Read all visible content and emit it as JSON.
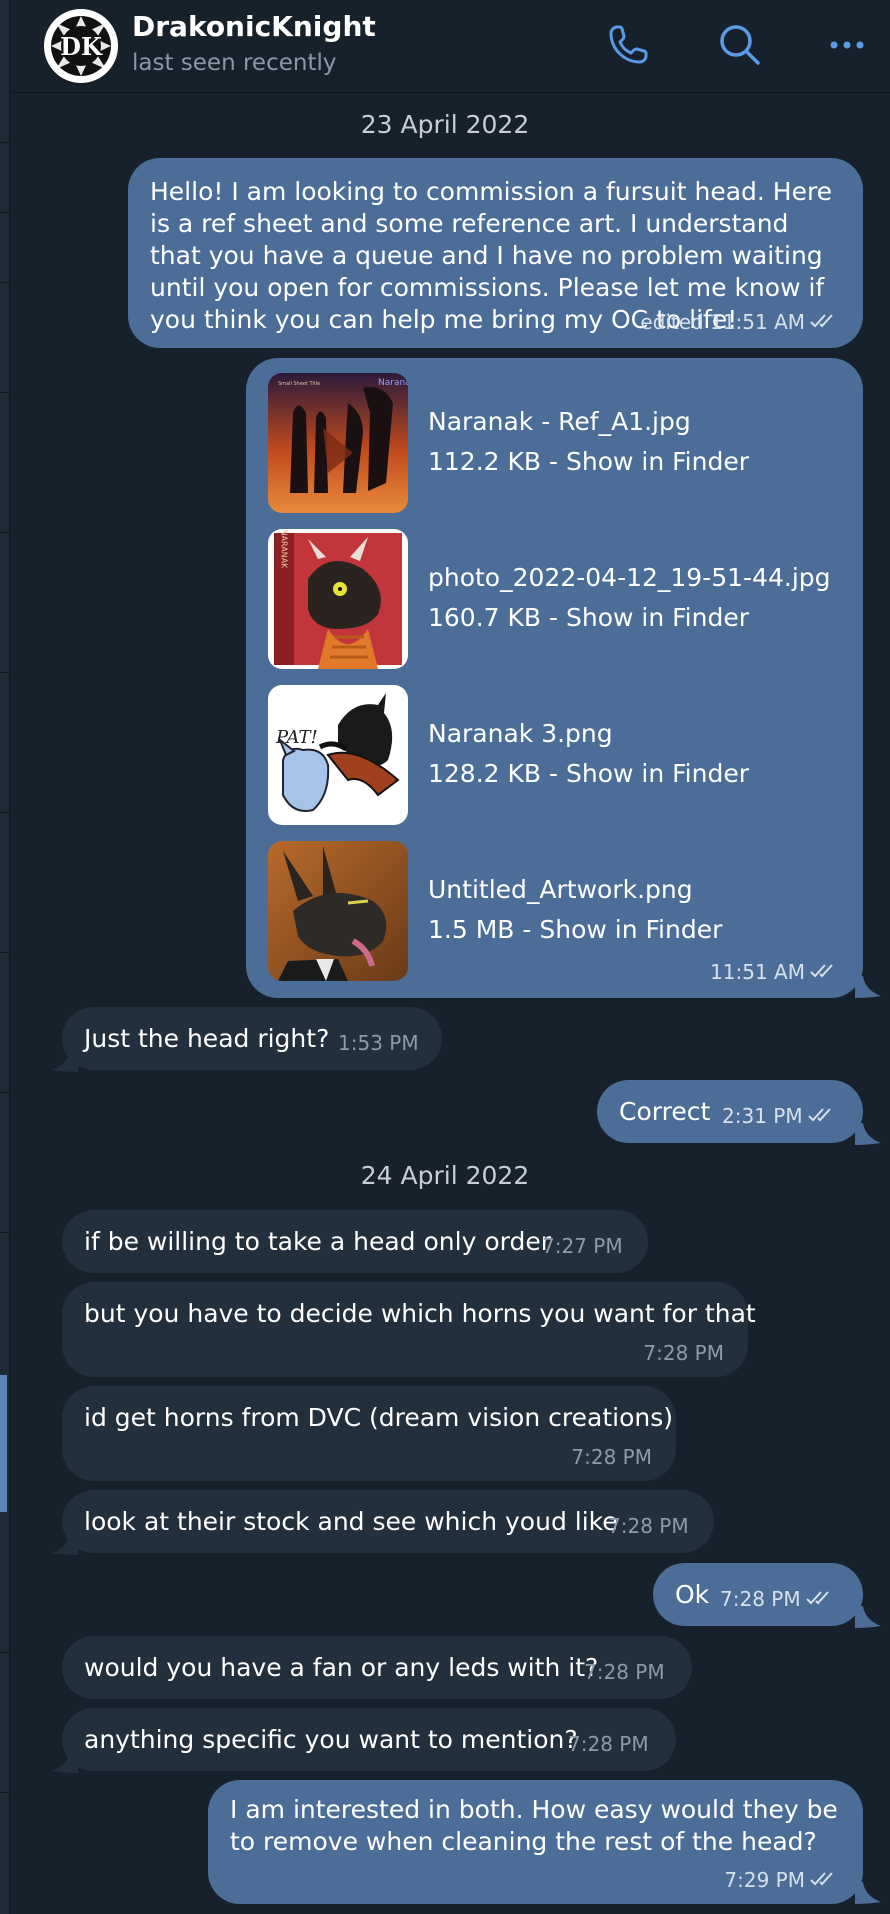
{
  "header": {
    "name": "DrakonicKnight",
    "status": "last seen recently",
    "avatar_text": "DK",
    "icons": [
      "phone-icon",
      "search-icon",
      "more-icon"
    ]
  },
  "colors": {
    "background": "#17212b",
    "outgoing_bubble": "#4c6d98",
    "incoming_bubble": "#222f3c",
    "accent": "#5b9ae8"
  },
  "dates": [
    "23 April 2022",
    "24 April 2022"
  ],
  "messages": [
    {
      "dir": "out",
      "text": "Hello! I am looking to commission a fursuit head. Here is a ref sheet and some reference art. I understand that you have a queue and I have no problem waiting until you open for commissions. Please let me know if you think you can help me bring my OC to life!",
      "time": "edited 11:51 AM",
      "read": true
    },
    {
      "dir": "in",
      "text": "Just the head right?",
      "time": "1:53 PM"
    },
    {
      "dir": "out",
      "text": "Correct",
      "time": "2:31 PM",
      "read": true
    },
    {
      "dir": "in",
      "text": "if be willing to take a head only order",
      "time": "7:27 PM"
    },
    {
      "dir": "in",
      "text": "but you have to decide which horns you want for that",
      "time": "7:28 PM"
    },
    {
      "dir": "in",
      "text": "id get horns from DVC (dream vision creations)",
      "time": "7:28 PM"
    },
    {
      "dir": "in",
      "text": "look at their stock and see which youd like",
      "time": "7:28 PM"
    },
    {
      "dir": "out",
      "text": "Ok",
      "time": "7:28 PM",
      "read": true
    },
    {
      "dir": "in",
      "text": "would you have a fan or any leds with it?",
      "time": "7:28 PM"
    },
    {
      "dir": "in",
      "text": "anything specific you want to mention?",
      "time": "7:28 PM"
    },
    {
      "dir": "out",
      "text": "I am interested in both. How easy would they be to remove when cleaning the rest of the head?",
      "time": "7:29 PM",
      "read": true
    }
  ],
  "files_message": {
    "time": "11:51 AM",
    "read": true,
    "files": [
      {
        "name": "Naranak - Ref_A1.jpg",
        "size": "112.2 KB",
        "link": "Show in Finder",
        "sep": " - ",
        "thumb_text": "Naranak",
        "thumb_caption": "Small Sheet Title"
      },
      {
        "name": "photo_2022-04-12_19-51-44.jpg",
        "size": "160.7 KB",
        "link": "Show in Finder",
        "sep": " - ",
        "thumb_text": "NARANAK"
      },
      {
        "name": "Naranak 3.png",
        "size": "128.2 KB",
        "link": "Show in Finder",
        "sep": " - ",
        "thumb_text": "PAT!"
      },
      {
        "name": "Untitled_Artwork.png",
        "size": "1.5 MB",
        "link": "Show in Finder",
        "sep": " - "
      }
    ]
  }
}
